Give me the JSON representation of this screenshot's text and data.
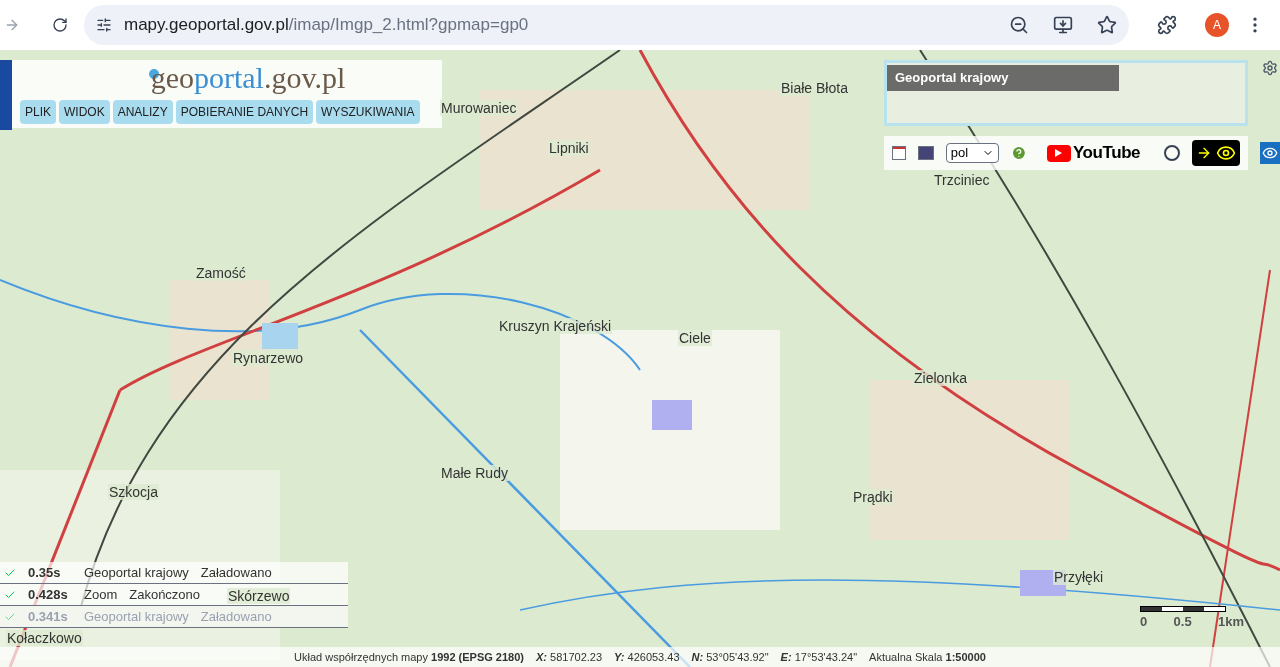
{
  "browser": {
    "url_host": "mapy.geoportal.gov.pl",
    "url_path": "/imap/Imgp_2.html?gpmap=gp0",
    "profile_initial": "A"
  },
  "logo": {
    "part_a": "geo",
    "part_b": "portal",
    "part_c": ".gov.pl"
  },
  "menu": [
    {
      "label": "PLIK"
    },
    {
      "label": "WIDOK"
    },
    {
      "label": "ANALIZY"
    },
    {
      "label": "POBIERANIE DANYCH"
    },
    {
      "label": "WYSZUKIWANIA"
    }
  ],
  "overview": {
    "title": "Geoportal krajowy"
  },
  "toolbar": {
    "language": "pol",
    "video_label": "YouTube",
    "high_contrast_on": false
  },
  "map_labels": [
    "Murowaniec",
    "Białe Błota",
    "Lipniki",
    "Trzciniec",
    "Zamość",
    "Kruszyn Krajeński",
    "Ciele",
    "Rynarzewo",
    "Zielonka",
    "Małe Rudy",
    "Szkocja",
    "Prądki",
    "Skórzewo",
    "Przyłęki",
    "Kołaczkowo"
  ],
  "log": [
    {
      "time": "0.35s",
      "layer": "Geoportal krajowy",
      "status": "Załadowano",
      "faded": false
    },
    {
      "time": "0.428s",
      "layer": "Zoom",
      "status": "Zakończono",
      "faded": false
    },
    {
      "time": "0.341s",
      "layer": "Geoportal krajowy",
      "status": "Załadowano",
      "faded": true
    }
  ],
  "scale_bar": {
    "ticks": [
      "0",
      "0.5",
      "1km"
    ]
  },
  "status_bar": {
    "crs": "Układ współrzędnych mapy **1992 (EPSG 2180)**",
    "coords": [
      {
        "label": "X:",
        "value": "581702.23"
      },
      {
        "label": "Y:",
        "value": "426053.43"
      },
      {
        "label": "N:",
        "value": "53°05'43.92\""
      },
      {
        "label": "E:",
        "value": "17°53'43.24\""
      }
    ],
    "scale": "Aktualna Skala **1:50000**"
  }
}
